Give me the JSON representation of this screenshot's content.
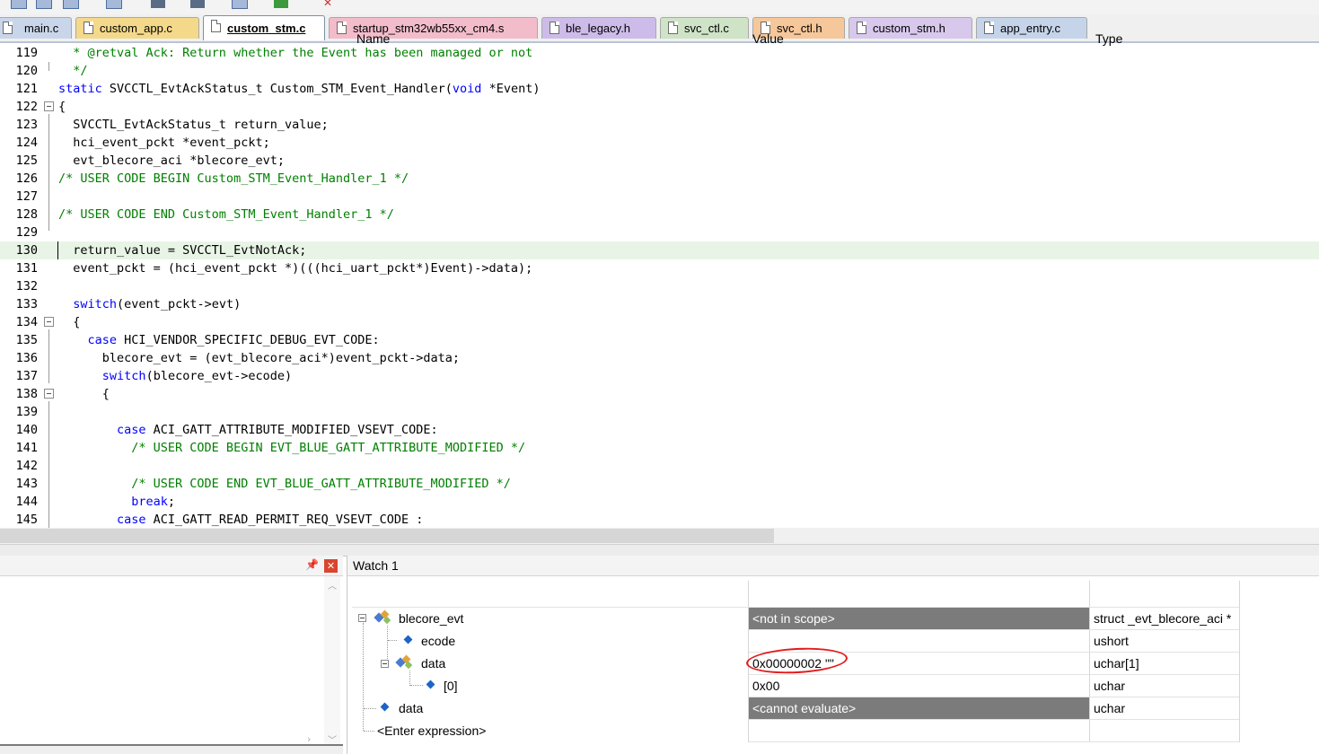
{
  "tabs": [
    {
      "label": "main.c",
      "color": "#c9d6ea"
    },
    {
      "label": "custom_app.c",
      "color": "#f4d98a"
    },
    {
      "label": "custom_stm.c",
      "color": "#ffffff",
      "active": true
    },
    {
      "label": "startup_stm32wb55xx_cm4.s",
      "color": "#f2bccb"
    },
    {
      "label": "ble_legacy.h",
      "color": "#cdbce9"
    },
    {
      "label": "svc_ctl.c",
      "color": "#cfe3c7"
    },
    {
      "label": "svc_ctl.h",
      "color": "#f6c79a"
    },
    {
      "label": "custom_stm.h",
      "color": "#d7c8ec"
    },
    {
      "label": "app_entry.c",
      "color": "#c6d4ea"
    }
  ],
  "code": {
    "lines": [
      {
        "n": "119",
        "text": "  * @retval Ack: Return whether the Event has been managed or not"
      },
      {
        "n": "120",
        "text": "  */"
      },
      {
        "n": "121",
        "text": "static SVCCTL_EvtAckStatus_t Custom_STM_Event_Handler(void *Event)"
      },
      {
        "n": "122",
        "text": "{"
      },
      {
        "n": "123",
        "text": "  SVCCTL_EvtAckStatus_t return_value;"
      },
      {
        "n": "124",
        "text": "  hci_event_pckt *event_pckt;"
      },
      {
        "n": "125",
        "text": "  evt_blecore_aci *blecore_evt;"
      },
      {
        "n": "126",
        "text": "/* USER CODE BEGIN Custom_STM_Event_Handler_1 */"
      },
      {
        "n": "127",
        "text": ""
      },
      {
        "n": "128",
        "text": "/* USER CODE END Custom_STM_Event_Handler_1 */"
      },
      {
        "n": "129",
        "text": ""
      },
      {
        "n": "130",
        "text": "  return_value = SVCCTL_EvtNotAck;"
      },
      {
        "n": "131",
        "text": "  event_pckt = (hci_event_pckt *)(((hci_uart_pckt*)Event)->data);"
      },
      {
        "n": "132",
        "text": ""
      },
      {
        "n": "133",
        "text": "  switch(event_pckt->evt)"
      },
      {
        "n": "134",
        "text": "  {"
      },
      {
        "n": "135",
        "text": "    case HCI_VENDOR_SPECIFIC_DEBUG_EVT_CODE:"
      },
      {
        "n": "136",
        "text": "      blecore_evt = (evt_blecore_aci*)event_pckt->data;"
      },
      {
        "n": "137",
        "text": "      switch(blecore_evt->ecode)"
      },
      {
        "n": "138",
        "text": "      {"
      },
      {
        "n": "139",
        "text": ""
      },
      {
        "n": "140",
        "text": "        case ACI_GATT_ATTRIBUTE_MODIFIED_VSEVT_CODE:"
      },
      {
        "n": "141",
        "text": "          /* USER CODE BEGIN EVT_BLUE_GATT_ATTRIBUTE_MODIFIED */"
      },
      {
        "n": "142",
        "text": ""
      },
      {
        "n": "143",
        "text": "          /* USER CODE END EVT_BLUE_GATT_ATTRIBUTE_MODIFIED */"
      },
      {
        "n": "144",
        "text": "          break;"
      },
      {
        "n": "145",
        "text": "        case ACI_GATT_READ_PERMIT_REQ_VSEVT_CODE :"
      }
    ]
  },
  "watch": {
    "title": "Watch 1",
    "headers": {
      "name": "Name",
      "value": "Value",
      "type": "Type"
    },
    "rows": [
      {
        "name": "blecore_evt",
        "value": "<not in scope>",
        "type": "struct _evt_blecore_aci *"
      },
      {
        "name": "ecode",
        "value": "",
        "type": "ushort"
      },
      {
        "name": "data",
        "value": "0x00000002 \"\"",
        "type": "uchar[1]"
      },
      {
        "name": "[0]",
        "value": "0x00",
        "type": "uchar"
      },
      {
        "name": "data",
        "value": "<cannot evaluate>",
        "type": "uchar"
      },
      {
        "name": "<Enter expression>",
        "value": "",
        "type": ""
      }
    ]
  },
  "colors": {
    "keyword": "#0000ff",
    "comment": "#008000",
    "current_line": "#e8f5e6",
    "out_of_scope_cell": "#7b7b7b",
    "annotation_circle": "#e21b1b"
  }
}
